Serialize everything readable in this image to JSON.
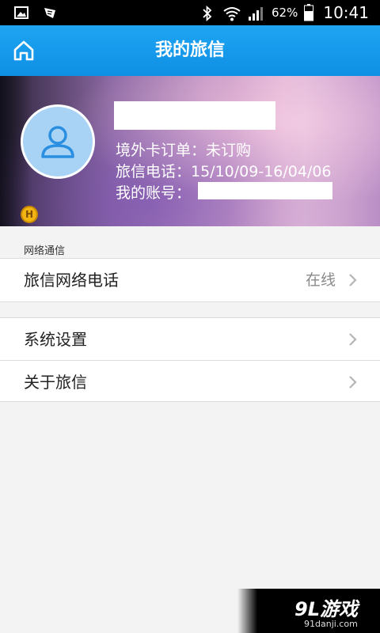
{
  "status_bar": {
    "battery_percent": "62%",
    "time": "10:41",
    "icons": [
      "gallery-icon",
      "notification-icon",
      "bluetooth-icon",
      "wifi-icon",
      "signal-icon",
      "battery-icon"
    ]
  },
  "app_bar": {
    "title": "我的旅信",
    "home_icon": "home-icon"
  },
  "profile": {
    "order_line": "境外卡订单：未订购",
    "phone_line": "旅信电话：15/10/09-16/04/06",
    "account_label": "我的账号：",
    "level_badge": "H"
  },
  "sections": {
    "network_label": "网络通信",
    "network_items": [
      {
        "label": "旅信网络电话",
        "status": "在线"
      }
    ],
    "other_items": [
      {
        "label": "系统设置"
      },
      {
        "label": "关于旅信"
      }
    ]
  },
  "watermark": {
    "main": "9L游戏",
    "sub": "91danji.com"
  },
  "colors": {
    "app_bar": "#1fa4f2",
    "avatar_bg": "#a9d3f5",
    "avatar_icon": "#2a8fe0",
    "page_bg": "#f3f3f3"
  }
}
